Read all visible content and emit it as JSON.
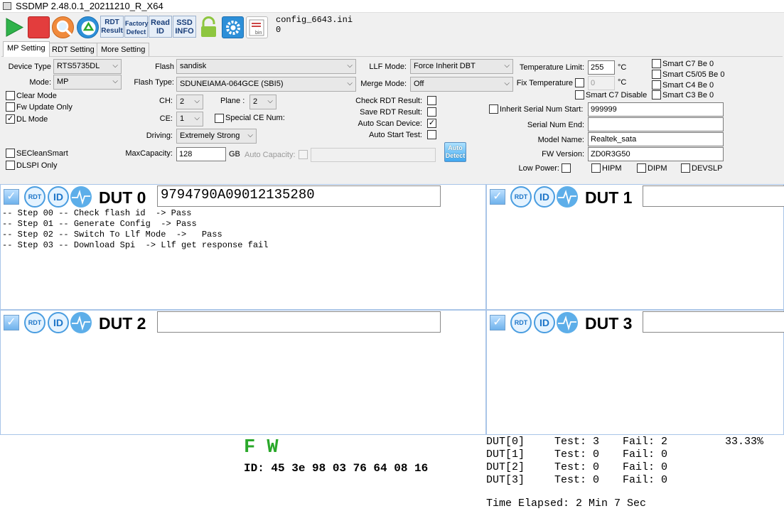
{
  "window": {
    "title": "SSDMP 2.48.0.1_20211210_R_X64"
  },
  "toolbar": {
    "rdt_result": "RDT Result",
    "factory_defect": "Factory Defect",
    "read_id": "Read ID",
    "ssd_info": "SSD INFO",
    "bin_label": "bin",
    "config_file": "config_6643.ini",
    "config_value": "0"
  },
  "tabs": [
    "MP Setting",
    "RDT Setting",
    "More Setting"
  ],
  "mp": {
    "device_type_label": "Device Type",
    "device_type": "RTS5735DL",
    "mode_label": "Mode:",
    "mode": "MP",
    "clear_mode": "Clear Mode",
    "fw_update_only": "Fw Update Only",
    "dl_mode": "DL Mode",
    "seclean_smart": "SECleanSmart",
    "dlspi_only": "DLSPI Only",
    "flash_label": "Flash",
    "flash": "sandisk",
    "flash_type_label": "Flash Type:",
    "flash_type": "SDUNEIAMA-064GCE (SBI5)",
    "ch_label": "CH:",
    "ch": "2",
    "plane_label": "Plane :",
    "plane": "2",
    "ce_label": "CE:",
    "ce": "1",
    "special_ce_num": "Special CE Num:",
    "driving_label": "Driving:",
    "driving": "Extremely Strong",
    "max_capacity_label": "MaxCapacity:",
    "max_capacity": "128",
    "gb": "GB",
    "auto_capacity": "Auto Capacity:",
    "auto_capacity_value": "",
    "llf_mode_label": "LLF Mode:",
    "llf_mode": "Force Inherit DBT",
    "merge_mode_label": "Merge Mode:",
    "merge_mode": "Off",
    "check_rdt_result": "Check RDT Result:",
    "save_rdt_result": "Save RDT Result:",
    "auto_scan_device": "Auto Scan Device:",
    "auto_start_test": "Auto Start Test:",
    "auto_detect": "Auto Detect",
    "temp_limit_label": "Temperature Limit:",
    "temp_limit": "255",
    "unit_c": "°C",
    "fix_temp_label": "Fix Temperature",
    "fix_temp": "0",
    "smart_c7_be_0": "Smart C7 Be 0",
    "smart_c5_05_be_0": "Smart C5/05 Be 0",
    "smart_c4_be_0": "Smart C4 Be 0",
    "smart_c3_be_0": "Smart C3 Be 0",
    "smart_c7_disable": "Smart C7 Disable",
    "inherit_serial_label": "Inherit  Serial Num Start:",
    "serial_start": "999999",
    "serial_end_label": "Serial Num End:",
    "serial_end": "",
    "model_name_label": "Model Name:",
    "model_name": "Realtek_sata",
    "fw_version_label": "FW Version:",
    "fw_version": "ZD0R3G50",
    "low_power_label": "Low Power:",
    "hipm": "HIPM",
    "dipm": "DIPM",
    "devslp": "DEVSLP"
  },
  "duts": [
    {
      "label": "DUT 0",
      "serial": "9794790A09012135280",
      "log": "-- Step 00 -- Check flash id  -> Pass\n-- Step 01 -- Generate Config  -> Pass\n-- Step 02 -- Switch To Llf Mode  ->   Pass\n-- Step 03 -- Download Spi  -> Llf get response fail"
    },
    {
      "label": "DUT 1",
      "serial": "",
      "log": ""
    },
    {
      "label": "DUT 2",
      "serial": "",
      "log": ""
    },
    {
      "label": "DUT 3",
      "serial": "",
      "log": ""
    }
  ],
  "dut_icons": {
    "rdt": "RDT",
    "id": "ID"
  },
  "summary": {
    "fw": "F W",
    "id_line": "ID: 45 3e 98 03 76 64 08 16",
    "rows": [
      {
        "dut": "DUT[0]",
        "test": "Test: 3",
        "fail": "Fail: 2",
        "pct": "33.33%"
      },
      {
        "dut": "DUT[1]",
        "test": "Test: 0",
        "fail": "Fail: 0",
        "pct": ""
      },
      {
        "dut": "DUT[2]",
        "test": "Test: 0",
        "fail": "Fail: 0",
        "pct": ""
      },
      {
        "dut": "DUT[3]",
        "test": "Test: 0",
        "fail": "Fail: 0",
        "pct": ""
      }
    ],
    "elapsed": "Time Elapsed: 2 Min 7 Sec"
  },
  "colors": {
    "accent": "#1b74c8",
    "fw_green": "#2aa82a",
    "start_green": "#2fb24a",
    "stop_red": "#e33d3d"
  },
  "icons": [
    "start-icon",
    "stop-icon",
    "search-icon",
    "recycle-icon",
    "lock-icon",
    "gear-icon",
    "bin-file-icon",
    "check-icon",
    "waveform-icon"
  ]
}
